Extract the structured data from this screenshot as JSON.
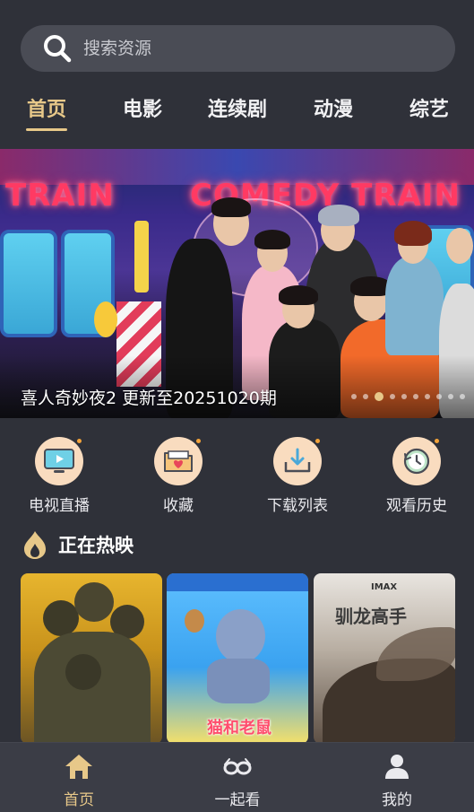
{
  "search": {
    "placeholder": "搜索资源"
  },
  "tabs": [
    {
      "label": "首页",
      "active": true
    },
    {
      "label": "电影",
      "active": false
    },
    {
      "label": "连续剧",
      "active": false
    },
    {
      "label": "动漫",
      "active": false
    },
    {
      "label": "综艺",
      "active": false
    }
  ],
  "banner": {
    "caption": "喜人奇妙夜2 更新至20251020期",
    "signs": [
      "TRAIN",
      "COMEDY TRAIN"
    ],
    "slide_count": 10,
    "active_slide": 3
  },
  "quick_links": [
    {
      "label": "电视直播",
      "icon": "tv-icon"
    },
    {
      "label": "收藏",
      "icon": "folder-heart-icon"
    },
    {
      "label": "下载列表",
      "icon": "download-icon"
    },
    {
      "label": "观看历史",
      "icon": "history-clock-icon"
    }
  ],
  "now_showing": {
    "title": "正在热映",
    "posters": [
      {
        "name": "military-movie"
      },
      {
        "name": "tom-and-jerry",
        "title_text": "猫和老鼠"
      },
      {
        "name": "how-to-train-your-dragon",
        "title_text": "驯龙高手",
        "badge": "IMAX"
      }
    ]
  },
  "bottom_nav": [
    {
      "label": "首页",
      "icon": "home-icon",
      "active": true
    },
    {
      "label": "一起看",
      "icon": "glasses-icon",
      "active": false
    },
    {
      "label": "我的",
      "icon": "user-icon",
      "active": false
    }
  ],
  "colors": {
    "background": "#2f3139",
    "accent": "#e7c889",
    "search_bg": "#4a4c55",
    "nav_bg": "#3b3d46",
    "quick_icon_bg": "#f9dcbf"
  }
}
